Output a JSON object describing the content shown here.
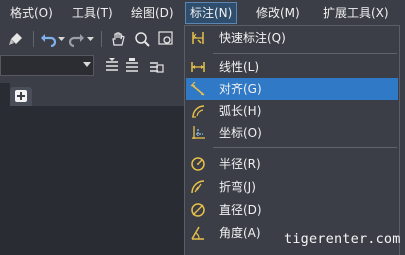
{
  "menubar": {
    "items": [
      {
        "label": "格式(O)"
      },
      {
        "label": "工具(T)"
      },
      {
        "label": "绘图(D)"
      },
      {
        "label": "标注(N)"
      },
      {
        "label": "修改(M)"
      },
      {
        "label": "扩展工具(X)"
      }
    ],
    "active_index": 3
  },
  "dropdown": {
    "highlight_index": 2,
    "items": [
      {
        "label": "快速标注(Q)",
        "icon": "quick-dimension-icon"
      },
      {
        "label": "线性(L)",
        "icon": "linear-dimension-icon"
      },
      {
        "label": "对齐(G)",
        "icon": "aligned-dimension-icon"
      },
      {
        "label": "弧长(H)",
        "icon": "arc-length-icon"
      },
      {
        "label": "坐标(O)",
        "icon": "ordinate-dimension-icon"
      },
      {
        "label": "半径(R)",
        "icon": "radius-dimension-icon"
      },
      {
        "label": "折弯(J)",
        "icon": "jogged-dimension-icon"
      },
      {
        "label": "直径(D)",
        "icon": "diameter-dimension-icon"
      },
      {
        "label": "角度(A)",
        "icon": "angular-dimension-icon"
      }
    ]
  },
  "watermark": "tigerenter.com",
  "colors": {
    "menubar_bg": "#3b3e47",
    "highlight": "#2f79c6",
    "icon_yellow": "#e8c04a",
    "icon_blue": "#8fc3ee"
  }
}
